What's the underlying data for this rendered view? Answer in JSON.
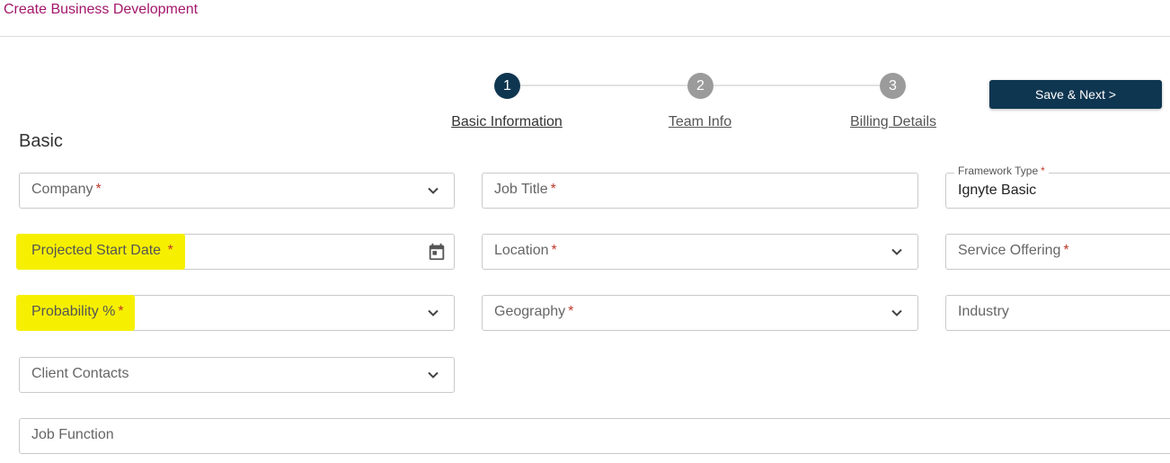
{
  "page": {
    "title": "Create Business Development"
  },
  "stepper": {
    "steps": [
      {
        "number": "1",
        "label": "Basic Information",
        "active": true
      },
      {
        "number": "2",
        "label": "Team Info",
        "active": false
      },
      {
        "number": "3",
        "label": "Billing Details",
        "active": false
      }
    ]
  },
  "actions": {
    "save_next": "Save & Next >"
  },
  "section": {
    "title": "Basic"
  },
  "required_mark": "*",
  "fields": {
    "company": "Company",
    "job_title": "Job Title",
    "framework_type_label": "Framework Type",
    "framework_type_value": "Ignyte Basic",
    "projected_start_date": "Projected Start Date",
    "location": "Location",
    "service_offering": "Service Offering",
    "probability": "Probability %",
    "geography": "Geography",
    "industry": "Industry",
    "client_contacts": "Client Contacts",
    "job_function": "Job Function"
  },
  "colors": {
    "title": "#a3176b",
    "primary": "#0f3651",
    "highlight": "#f6f000",
    "required": "#c0392b"
  }
}
